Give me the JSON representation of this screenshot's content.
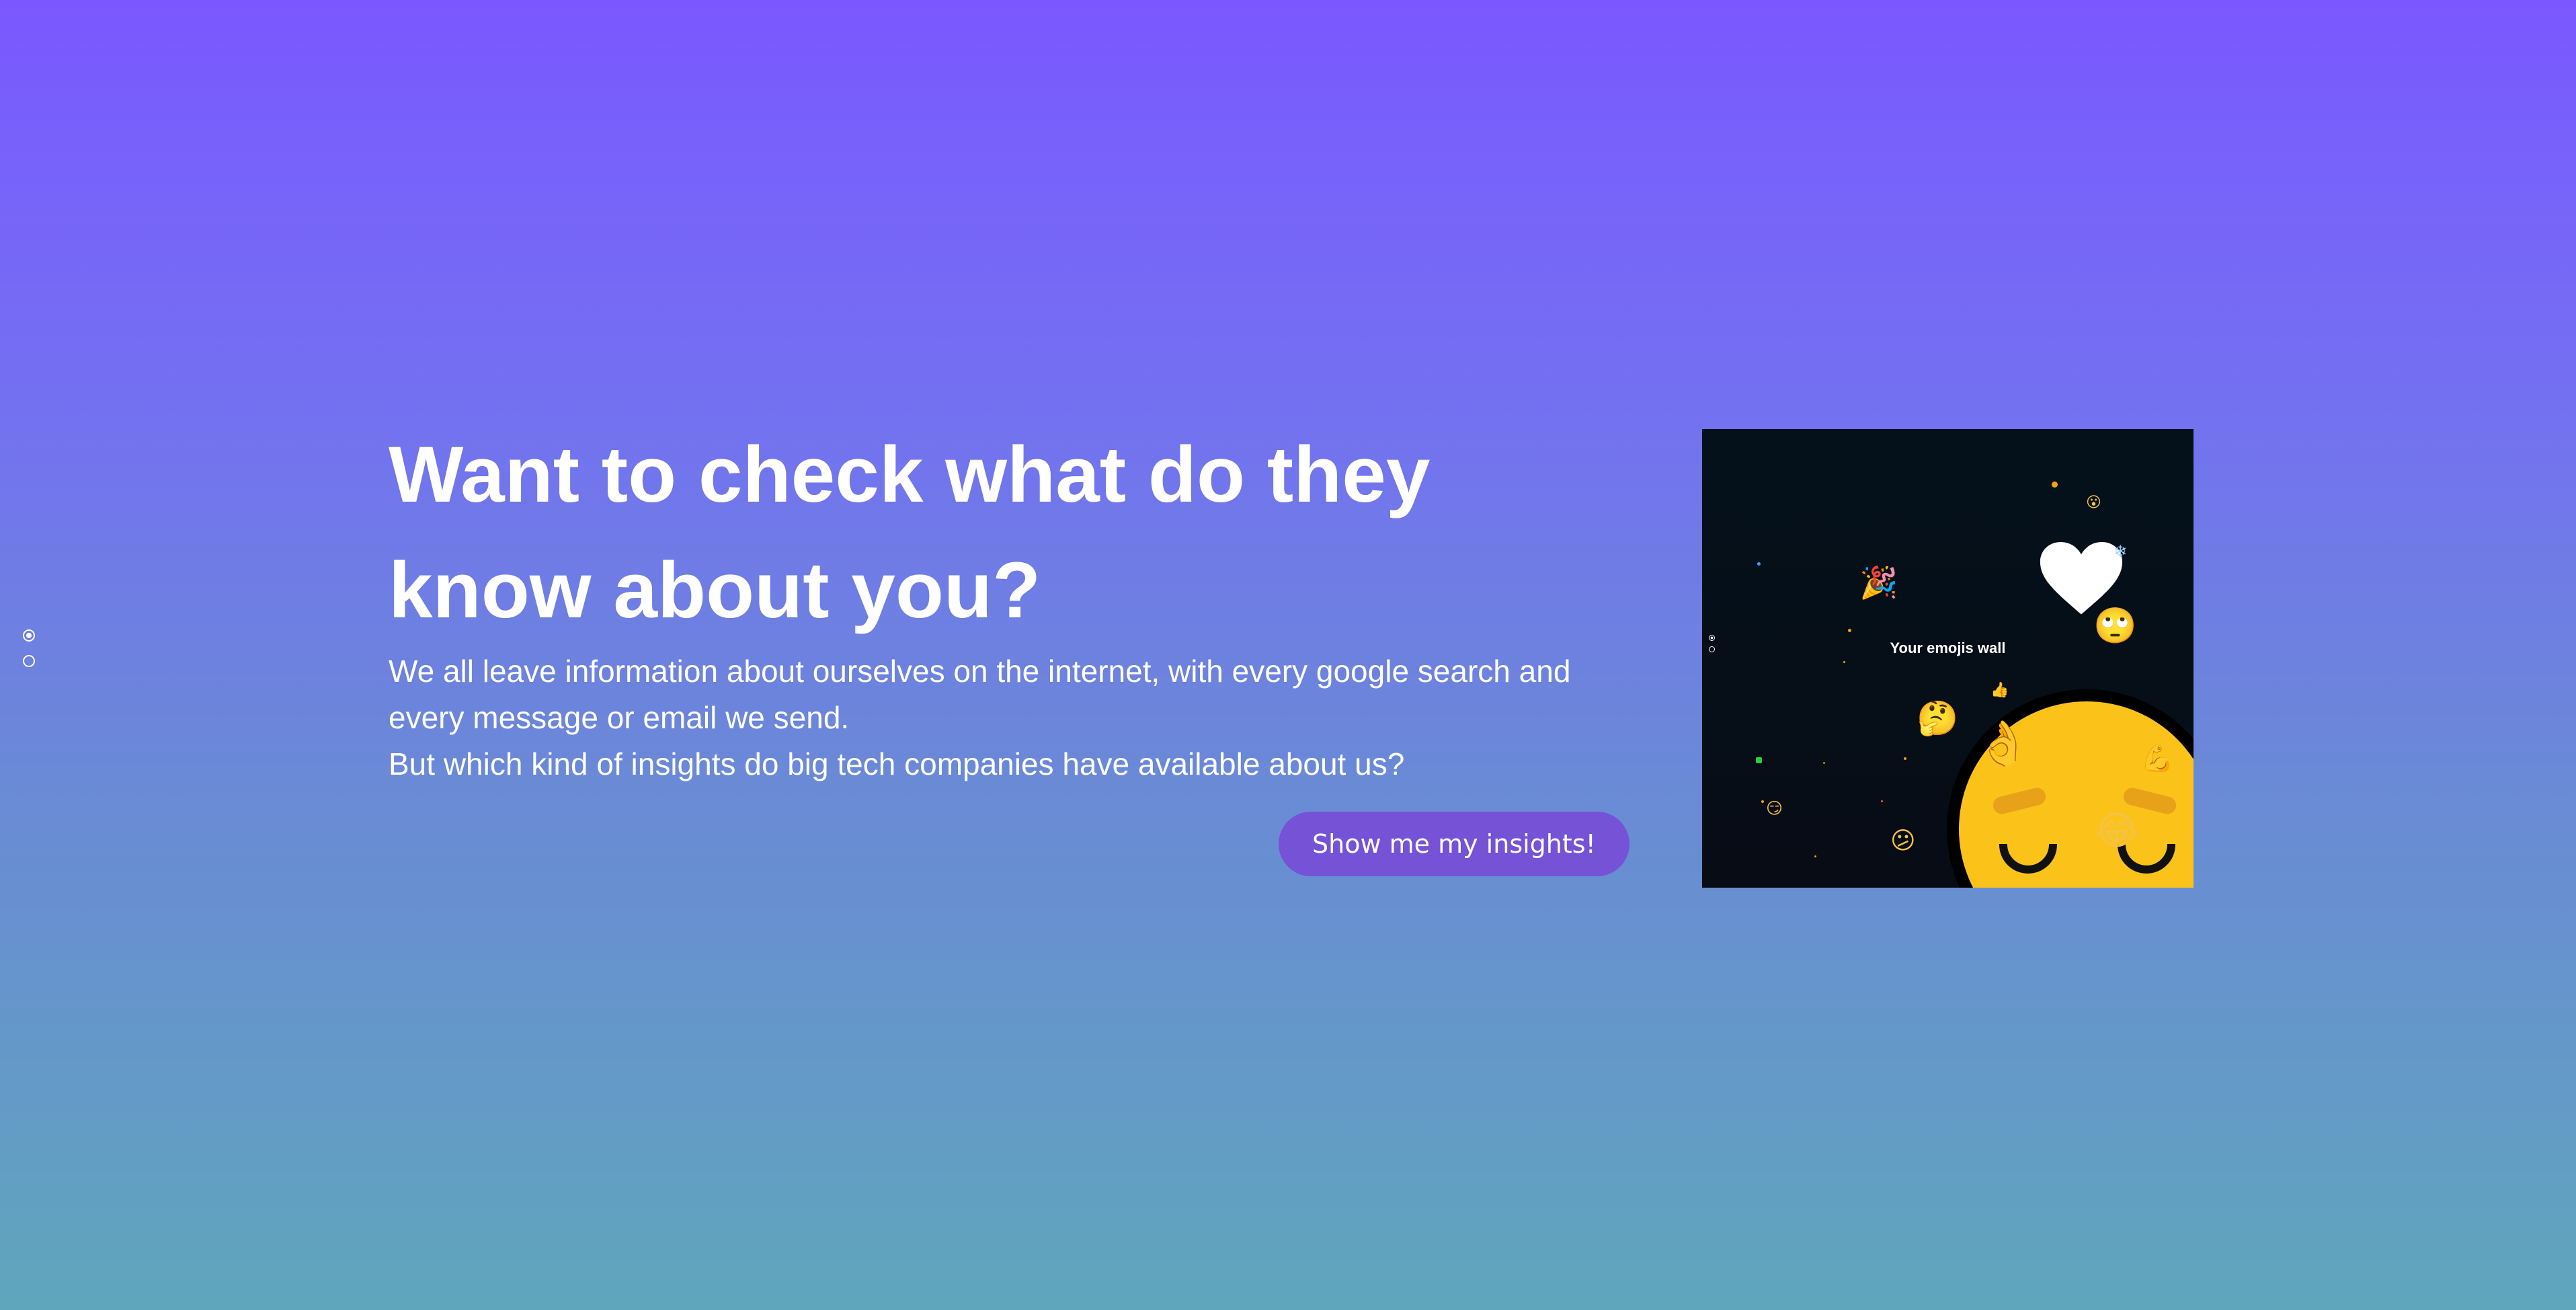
{
  "hero": {
    "title": "Want to check what do they know about you?",
    "body_line1": "We all leave information about ourselves on the internet, with every google search and every message or email we send.",
    "body_line2": "But which kind of insights do big tech companies have available about us?",
    "cta_label": "Show me my insights!"
  },
  "page_dots": {
    "count": 2,
    "active_index": 0
  },
  "preview": {
    "title": "Your emojis wall",
    "emojis": [
      "🎉",
      "😮",
      "🙄",
      "🤔",
      "👍",
      "👌",
      "💪",
      "😂",
      "😕",
      "😏",
      "❄"
    ]
  },
  "colors": {
    "gradient_top": "#7a58ff",
    "gradient_bottom": "#5fa6bc",
    "cta_bg": "#7652d7",
    "preview_bg": "#04111b",
    "face_yellow": "#fbc31a"
  }
}
